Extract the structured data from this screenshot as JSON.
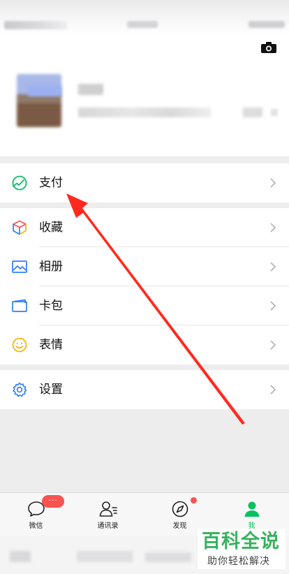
{
  "menu": {
    "pay": {
      "label": "支付",
      "icon": "wallet-check-icon"
    },
    "items": [
      {
        "label": "收藏",
        "icon": "cube-icon"
      },
      {
        "label": "相册",
        "icon": "photo-icon"
      },
      {
        "label": "卡包",
        "icon": "card-icon"
      },
      {
        "label": "表情",
        "icon": "smile-icon"
      }
    ],
    "settings": {
      "label": "设置",
      "icon": "gear-icon"
    }
  },
  "tabbar": {
    "tabs": [
      {
        "label": "微信",
        "icon": "chat-bubble-icon"
      },
      {
        "label": "通讯录",
        "icon": "contacts-icon"
      },
      {
        "label": "发现",
        "icon": "compass-icon"
      },
      {
        "label": "我",
        "icon": "person-icon",
        "active": true
      }
    ],
    "chats_badge": "···"
  },
  "watermark": {
    "title": "百科全说",
    "subtitle": "助你轻松解决"
  },
  "colors": {
    "accent": "#07c160",
    "badge": "#fa5151",
    "annotation_arrow": "#ff2a1f",
    "watermark": "#36b25e"
  }
}
